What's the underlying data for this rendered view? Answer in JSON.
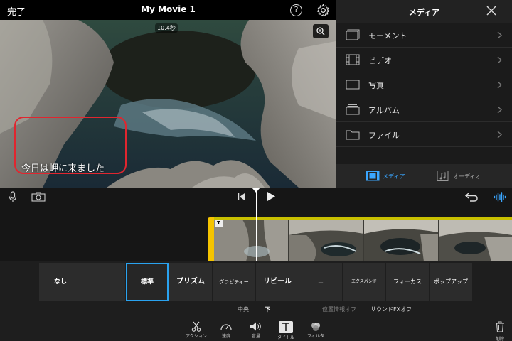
{
  "topbar": {
    "done_label": "完了",
    "movie_title": "My Movie 1",
    "help_label": "?"
  },
  "preview": {
    "duration": "10.4秒",
    "caption": "今日は岬に来ました",
    "highlight_color": "#e0262f"
  },
  "media_panel": {
    "title": "メディア",
    "items": [
      {
        "label": "モーメント",
        "icon": "moments-icon"
      },
      {
        "label": "ビデオ",
        "icon": "video-icon"
      },
      {
        "label": "写真",
        "icon": "photo-icon"
      },
      {
        "label": "アルバム",
        "icon": "album-icon"
      },
      {
        "label": "ファイル",
        "icon": "folder-icon"
      }
    ],
    "tabs": [
      {
        "label": "メディア",
        "icon": "filmstrip-icon",
        "active": true
      },
      {
        "label": "オーディオ",
        "icon": "music-note-icon",
        "active": false
      }
    ],
    "accent_color": "#3aa6ff"
  },
  "timeline": {
    "title_marker": "T",
    "clip_handle_color": "#f5c400"
  },
  "title_styles": {
    "tiles": [
      "なし",
      "...",
      "標準",
      "プリズム",
      "グラビティー",
      "リビール",
      "—",
      "エクスパンド",
      "フォーカス",
      "ポップアップ"
    ],
    "selected_index": 2,
    "selected_color": "#2aa3f0"
  },
  "options": {
    "position_center": "中央",
    "position_bottom": "下",
    "location_info": "位置情報オフ",
    "sound_fx": "サウンドFXオフ"
  },
  "toolbar": {
    "tools": [
      {
        "label": "アクション",
        "icon": "scissors-icon"
      },
      {
        "label": "速度",
        "icon": "speedometer-icon"
      },
      {
        "label": "音量",
        "icon": "speaker-icon"
      },
      {
        "label": "タイトル",
        "icon": "title-T-icon"
      },
      {
        "label": "フィルタ",
        "icon": "filter-circles-icon"
      }
    ],
    "delete_label": "削除"
  }
}
